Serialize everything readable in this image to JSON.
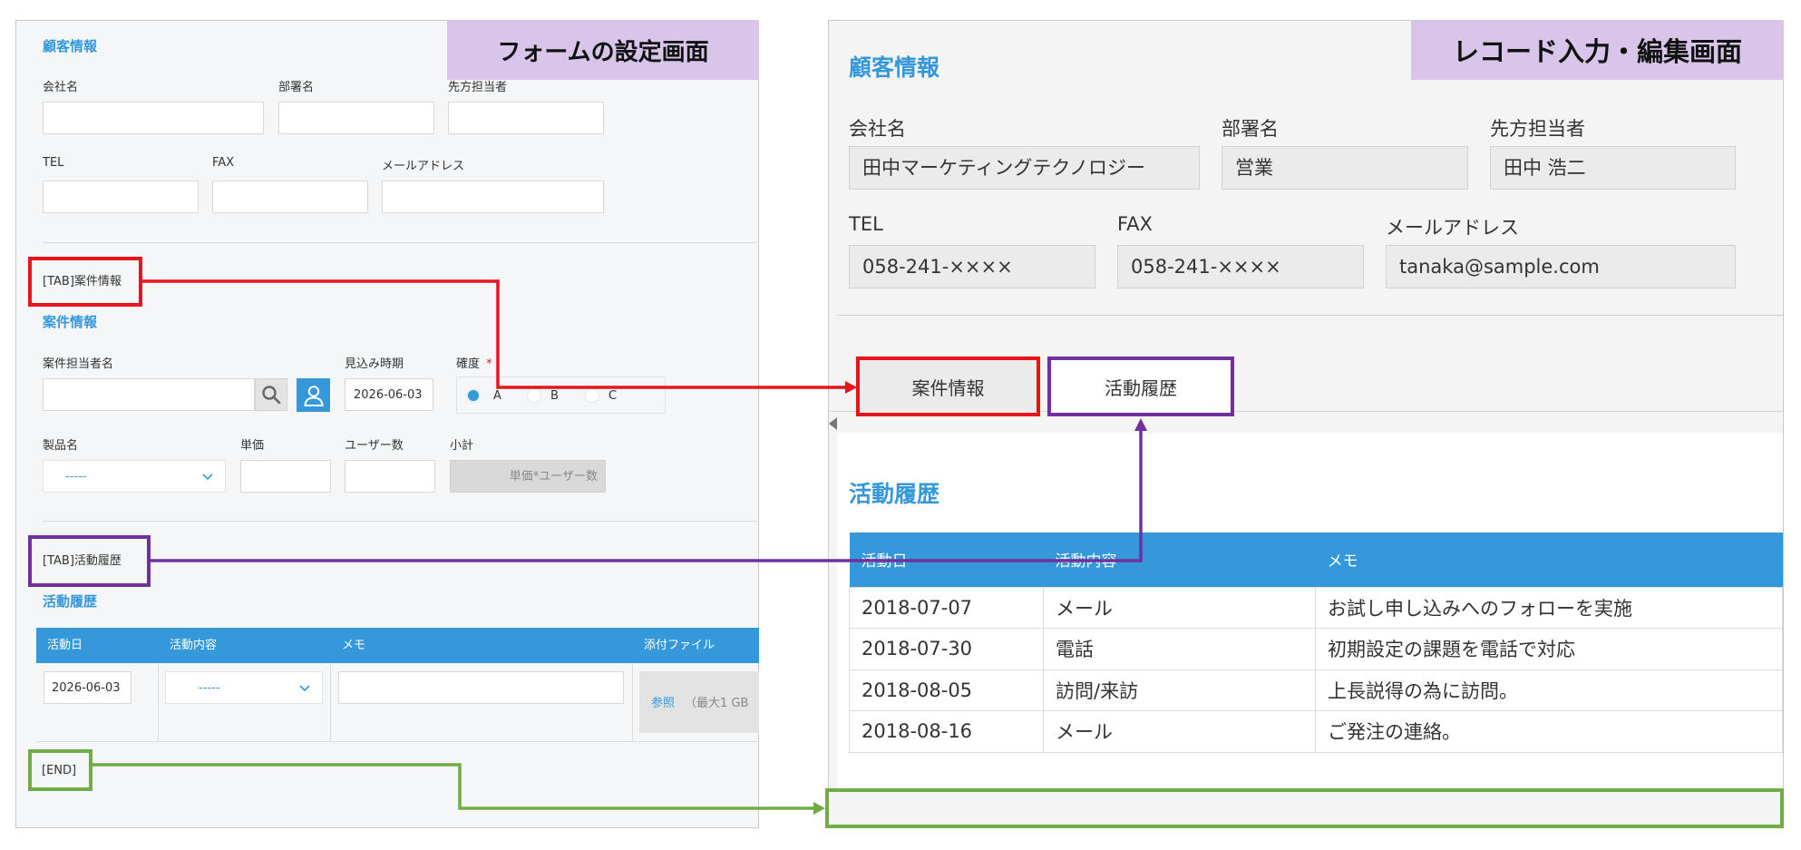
{
  "colors": {
    "accent_blue": "#3498db",
    "red": "#e8141b",
    "purple": "#7030a0",
    "green": "#70ad47",
    "banner_bg": "#d9c4ea"
  },
  "left": {
    "banner": "フォームの設定画面",
    "customer": {
      "title": "顧客情報",
      "company_label": "会社名",
      "dept_label": "部署名",
      "contact_label": "先方担当者",
      "tel_label": "TEL",
      "fax_label": "FAX",
      "email_label": "メールアドレス"
    },
    "tab1_marker": "[TAB]案件情報",
    "deal": {
      "title": "案件情報",
      "owner_label": "案件担当者名",
      "period_label": "見込み時期",
      "period_value": "2026-06-03",
      "prob_label": "確度",
      "required_mark": "*",
      "prob_options": [
        "A",
        "B",
        "C"
      ],
      "product_label": "製品名",
      "product_value": "-----",
      "price_label": "単価",
      "users_label": "ユーザー数",
      "subtotal_label": "小計",
      "subtotal_formula": "単価*ユーザー数",
      "search_icon": "search-icon",
      "user_icon": "user-icon"
    },
    "tab2_marker": "[TAB]活動履歴",
    "activity": {
      "title": "活動履歴",
      "headers": [
        "活動日",
        "活動内容",
        "メモ",
        "添付ファイル"
      ],
      "date_value": "2026-06-03",
      "content_value": "-----",
      "browse_label": "参照",
      "max_size": "（最大1 GB"
    },
    "end_marker": "[END]"
  },
  "right": {
    "banner": "レコード入力・編集画面",
    "customer": {
      "title": "顧客情報",
      "company_label": "会社名",
      "company_value": "田中マーケティングテクノロジー",
      "dept_label": "部署名",
      "dept_value": "営業",
      "contact_label": "先方担当者",
      "contact_value": "田中 浩二",
      "tel_label": "TEL",
      "tel_value": "058-241-××××",
      "fax_label": "FAX",
      "fax_value": "058-241-××××",
      "email_label": "メールアドレス",
      "email_value": "tanaka@sample.com"
    },
    "tabs": [
      "案件情報",
      "活動履歴"
    ],
    "activity": {
      "title": "活動履歴",
      "headers": [
        "活動日",
        "活動内容",
        "メモ"
      ],
      "rows": [
        [
          "2018-07-07",
          "メール",
          "お試し申し込みへのフォローを実施"
        ],
        [
          "2018-07-30",
          "電話",
          "初期設定の課題を電話で対応"
        ],
        [
          "2018-08-05",
          "訪問/来訪",
          "上長説得の為に訪問。"
        ],
        [
          "2018-08-16",
          "メール",
          "ご発注の連絡。"
        ]
      ]
    }
  }
}
